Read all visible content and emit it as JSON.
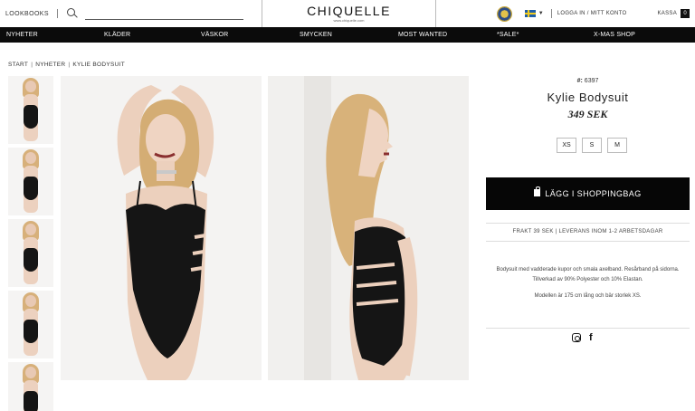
{
  "header": {
    "lookbooks": "LOOKBOOKS",
    "search_placeholder": "",
    "logo": "CHIQUELLE",
    "logo_sub": "www.chiquelle.com",
    "login": "LOGGA IN / MITT KONTO",
    "kassa": "KASSA",
    "cart_count": "0"
  },
  "nav": {
    "items": [
      "NYHETER",
      "KLÄDER",
      "VÄSKOR",
      "SMYCKEN",
      "MOST WANTED",
      "*SALE*",
      "X-MAS SHOP"
    ]
  },
  "breadcrumb": {
    "items": [
      "START",
      "NYHETER",
      "KYLIE BODYSUIT"
    ],
    "separator": "|"
  },
  "product": {
    "sku_label": "#:",
    "sku": "6397",
    "name": "Kylie Bodysuit",
    "price": "349 SEK",
    "sizes": [
      "XS",
      "S",
      "M"
    ],
    "buy_label": "LÄGG I SHOPPINGBAG",
    "shipping": "FRAKT 39 SEK | LEVERANS INOM 1-2 ARBETSDAGAR",
    "description": "Bodysuit med vadderade kupor och smala axelband. Resårband på sidorna. Tillverkad av 90% Polyester och 10% Elastan.",
    "model_note": "Modellen är 175 cm lång och bär storlek XS."
  },
  "icons": {
    "search": "search-icon",
    "seal": "trust-seal-icon",
    "flag": "sweden-flag-icon",
    "bag": "shopping-bag-icon",
    "instagram": "instagram-icon",
    "facebook": "facebook-icon"
  },
  "colors": {
    "nav_bg": "#0b0b0b",
    "button_bg": "#060606",
    "swimsuit": "#151515"
  }
}
